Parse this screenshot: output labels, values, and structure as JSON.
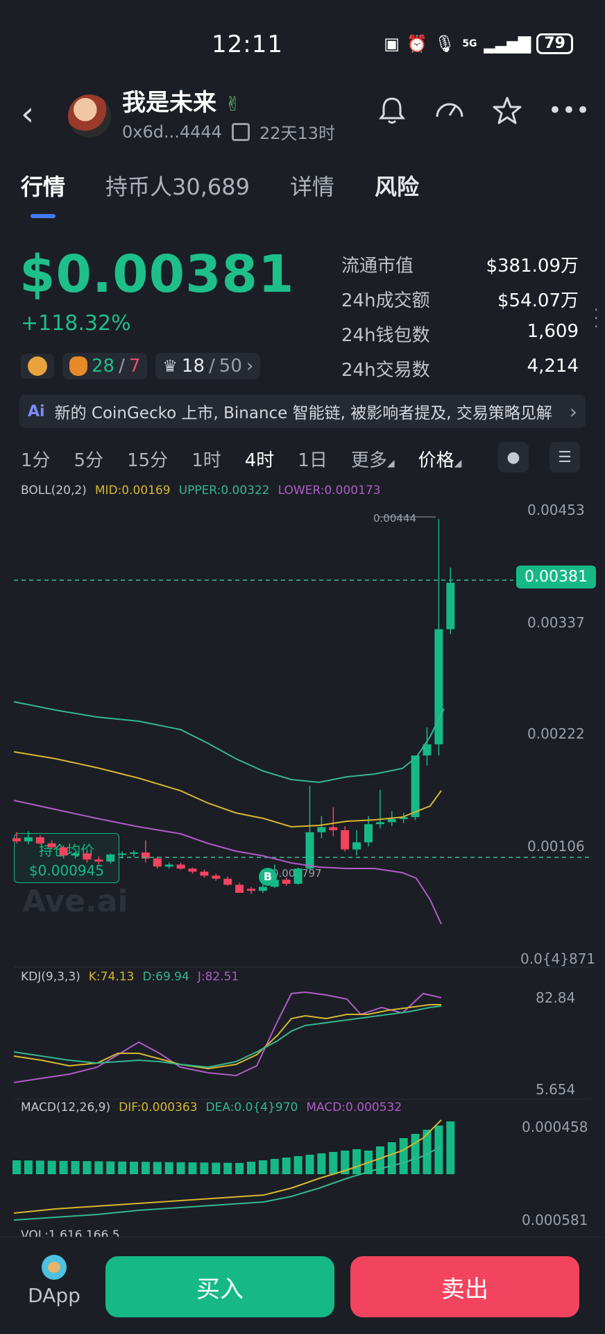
{
  "status": {
    "time": "12:11",
    "icons": [
      "nfc-icon",
      "alarm-icon",
      "mic-icon",
      "5g-icon",
      "signal-icon"
    ],
    "battery": "79"
  },
  "header": {
    "title": "我是未来",
    "title_emoji": "✌",
    "address": "0x6d...4444",
    "age": "22天13时"
  },
  "tabs": [
    {
      "label": "行情",
      "active": true
    },
    {
      "label": "持币人30,689",
      "active": false
    },
    {
      "label": "详情",
      "active": false
    },
    {
      "label": "风险",
      "active": false
    }
  ],
  "price": {
    "value": "$0.00381",
    "change": "+118.32%"
  },
  "badges": {
    "b1_a": "28",
    "b1_sep": "/",
    "b1_b": "7",
    "b2_a": "18",
    "b2_sep": "/",
    "b2_b": "50"
  },
  "stats": [
    {
      "label": "流通市值",
      "value": "$381.09万"
    },
    {
      "label": "24h成交额",
      "value": "$54.07万"
    },
    {
      "label": "24h钱包数",
      "value": "1,609"
    },
    {
      "label": "24h交易数",
      "value": "4,214"
    }
  ],
  "news": {
    "tag": "Ai",
    "text": "新的 CoinGecko 上市, Binance 智能链, 被影响者提及, 交易策略见解"
  },
  "timeframes": [
    "1分",
    "5分",
    "15分",
    "1时",
    "4时",
    "1日"
  ],
  "timeframe_active": "4时",
  "more_label": "更多",
  "price_label": "价格",
  "boll": {
    "name": "BOLL(20,2)",
    "mid": "MID:0.00169",
    "upper": "UPPER:0.00322",
    "lower": "LOWER:0.000173"
  },
  "price_axis": [
    "0.00453",
    "0.00337",
    "0.00222",
    "0.00106",
    "0.0{4}871"
  ],
  "current_price_tag": "0.00381",
  "high_label": "0.00444",
  "low_label": "0.000797",
  "holding": {
    "title": "持仓均价",
    "value": "$0.000945",
    "buy_marker": "B"
  },
  "watermark": "Ave.ai",
  "kdj": {
    "name": "KDJ(9,3,3)",
    "k": "K:74.13",
    "d": "D:69.94",
    "j": "J:82.51",
    "top": "82.84",
    "bottom": "5.654"
  },
  "macd": {
    "name": "MACD(12,26,9)",
    "dif": "DIF:0.000363",
    "dea": "DEA:0.0{4}970",
    "macd": "MACD:0.000532",
    "top": "0.000458",
    "bottom": "0.000581"
  },
  "vol": {
    "label": "VOL:1,616,166.5"
  },
  "bottom": {
    "dapp": "DApp",
    "buy": "买入",
    "sell": "卖出"
  },
  "colors": {
    "up": "#16b985",
    "down": "#f2445e",
    "accent": "#3f7bf6"
  },
  "chart_data": {
    "type": "candlestick",
    "title": "",
    "ylim": [
      8.71e-05,
      0.00453
    ],
    "candles": [
      {
        "o": 0.00128,
        "h": 0.00134,
        "l": 0.00123,
        "c": 0.00125
      },
      {
        "o": 0.00125,
        "h": 0.00135,
        "l": 0.00122,
        "c": 0.00129
      },
      {
        "o": 0.00129,
        "h": 0.00131,
        "l": 0.00122,
        "c": 0.00123
      },
      {
        "o": 0.00123,
        "h": 0.00126,
        "l": 0.00117,
        "c": 0.00119
      },
      {
        "o": 0.00119,
        "h": 0.00121,
        "l": 0.00108,
        "c": 0.00111
      },
      {
        "o": 0.00111,
        "h": 0.00115,
        "l": 0.00108,
        "c": 0.00113
      },
      {
        "o": 0.00113,
        "h": 0.00115,
        "l": 0.00104,
        "c": 0.00107
      },
      {
        "o": 0.00107,
        "h": 0.0011,
        "l": 0.00102,
        "c": 0.00105
      },
      {
        "o": 0.00105,
        "h": 0.00113,
        "l": 0.00103,
        "c": 0.00112
      },
      {
        "o": 0.00112,
        "h": 0.00115,
        "l": 0.00108,
        "c": 0.00113
      },
      {
        "o": 0.00113,
        "h": 0.00116,
        "l": 0.0011,
        "c": 0.00114
      },
      {
        "o": 0.00114,
        "h": 0.00126,
        "l": 0.00104,
        "c": 0.00108
      },
      {
        "o": 0.00108,
        "h": 0.0011,
        "l": 0.00098,
        "c": 0.001
      },
      {
        "o": 0.001,
        "h": 0.00104,
        "l": 0.00098,
        "c": 0.00102
      },
      {
        "o": 0.00102,
        "h": 0.00104,
        "l": 0.00097,
        "c": 0.00098
      },
      {
        "o": 0.00098,
        "h": 0.00099,
        "l": 0.00093,
        "c": 0.00095
      },
      {
        "o": 0.00095,
        "h": 0.00097,
        "l": 0.00089,
        "c": 0.00091
      },
      {
        "o": 0.00091,
        "h": 0.00093,
        "l": 0.00086,
        "c": 0.00088
      },
      {
        "o": 0.00088,
        "h": 0.0009,
        "l": 0.00081,
        "c": 0.00082
      },
      {
        "o": 0.00082,
        "h": 0.00084,
        "l": 0.00075,
        "c": 0.00074
      },
      {
        "o": 0.00078,
        "h": 0.0008,
        "l": 0.00073,
        "c": 0.00076
      },
      {
        "o": 0.00076,
        "h": 0.00082,
        "l": 0.00074,
        "c": 0.0008
      },
      {
        "o": 0.0008,
        "h": 0.00102,
        "l": 0.00079,
        "c": 0.00087
      },
      {
        "o": 0.00087,
        "h": 0.00089,
        "l": 0.00081,
        "c": 0.00083
      },
      {
        "o": 0.00083,
        "h": 0.00099,
        "l": 0.00082,
        "c": 0.00098
      },
      {
        "o": 0.00098,
        "h": 0.0018,
        "l": 0.00096,
        "c": 0.00134
      },
      {
        "o": 0.00134,
        "h": 0.0015,
        "l": 0.00128,
        "c": 0.00139
      },
      {
        "o": 0.00139,
        "h": 0.00159,
        "l": 0.0013,
        "c": 0.00136
      },
      {
        "o": 0.00136,
        "h": 0.0014,
        "l": 0.00115,
        "c": 0.00117
      },
      {
        "o": 0.00117,
        "h": 0.00136,
        "l": 0.00111,
        "c": 0.00124
      },
      {
        "o": 0.00124,
        "h": 0.0015,
        "l": 0.0012,
        "c": 0.00142
      },
      {
        "o": 0.00142,
        "h": 0.00176,
        "l": 0.00138,
        "c": 0.00144
      },
      {
        "o": 0.00144,
        "h": 0.00155,
        "l": 0.0014,
        "c": 0.00147
      },
      {
        "o": 0.00147,
        "h": 0.00153,
        "l": 0.00143,
        "c": 0.00149
      },
      {
        "o": 0.00149,
        "h": 0.0021,
        "l": 0.00146,
        "c": 0.0021
      },
      {
        "o": 0.0021,
        "h": 0.00238,
        "l": 0.002,
        "c": 0.00221
      },
      {
        "o": 0.00221,
        "h": 0.00444,
        "l": 0.0021,
        "c": 0.00335
      },
      {
        "o": 0.00335,
        "h": 0.00396,
        "l": 0.0033,
        "c": 0.00381
      }
    ]
  }
}
